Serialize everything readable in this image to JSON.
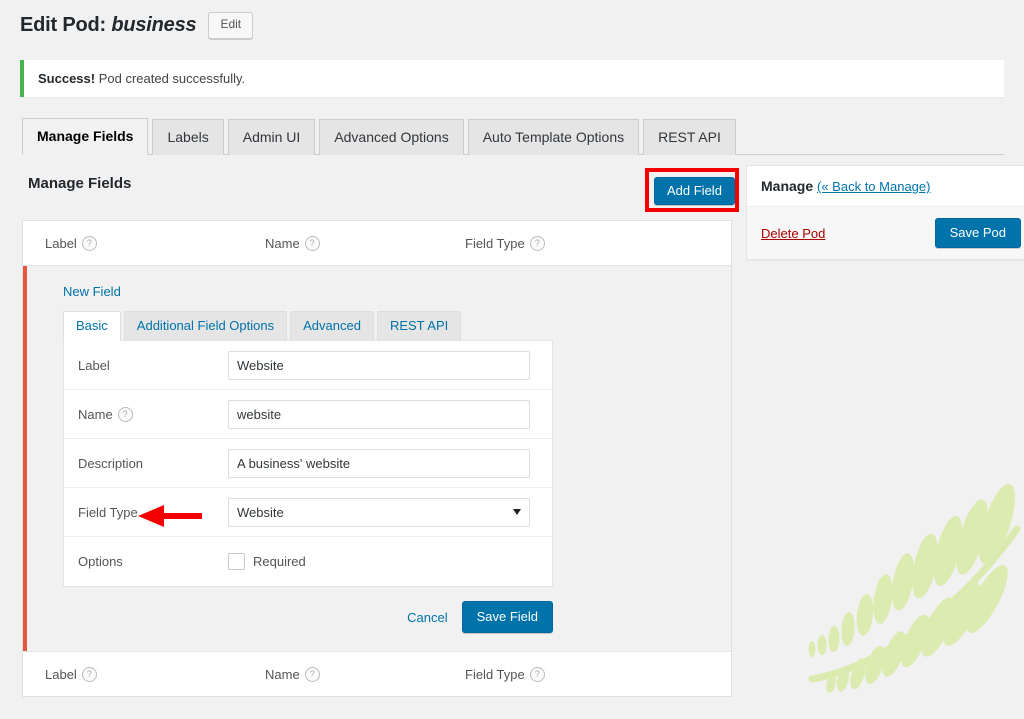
{
  "header": {
    "title_prefix": "Edit Pod: ",
    "pod_name": "business",
    "edit_button": "Edit"
  },
  "notice": {
    "strong": "Success!",
    "message": " Pod created successfully."
  },
  "main_tabs": [
    {
      "label": "Manage Fields",
      "active": true
    },
    {
      "label": "Labels",
      "active": false
    },
    {
      "label": "Admin UI",
      "active": false
    },
    {
      "label": "Advanced Options",
      "active": false
    },
    {
      "label": "Auto Template Options",
      "active": false
    },
    {
      "label": "REST API",
      "active": false
    }
  ],
  "main": {
    "section_heading": "Manage Fields",
    "add_field_button": "Add Field",
    "table_columns": [
      {
        "label": "Label",
        "help": "?"
      },
      {
        "label": "Name",
        "help": "?"
      },
      {
        "label": "Field Type",
        "help": "?"
      }
    ],
    "editing_row": {
      "heading": "New Field",
      "sub_tabs": [
        {
          "label": "Basic",
          "active": true
        },
        {
          "label": "Additional Field Options",
          "active": false
        },
        {
          "label": "Advanced",
          "active": false
        },
        {
          "label": "REST API",
          "active": false
        }
      ],
      "fields": {
        "label_row_label": "Label",
        "label_value": "Website",
        "name_row_label": "Name",
        "name_help": "?",
        "name_value": "website",
        "description_row_label": "Description",
        "description_value": "A business' website",
        "field_type_row_label": "Field Type",
        "field_type_value": "Website",
        "options_row_label": "Options",
        "required_checkbox_label": "Required",
        "required_checked": false
      },
      "actions": {
        "cancel": "Cancel",
        "save": "Save Field"
      }
    }
  },
  "sidebar": {
    "title": "Manage",
    "back_link": "(« Back to Manage)",
    "delete_link": "Delete Pod",
    "save_button": "Save Pod"
  },
  "colors": {
    "accent_blue": "#0073aa",
    "success_green": "#46b450",
    "annotation_red": "#f40000",
    "editing_bar_orange": "#e8543f",
    "delete_red": "#a00",
    "page_bg": "#f1f1f1",
    "watermark_green": "#d8e9a8"
  }
}
